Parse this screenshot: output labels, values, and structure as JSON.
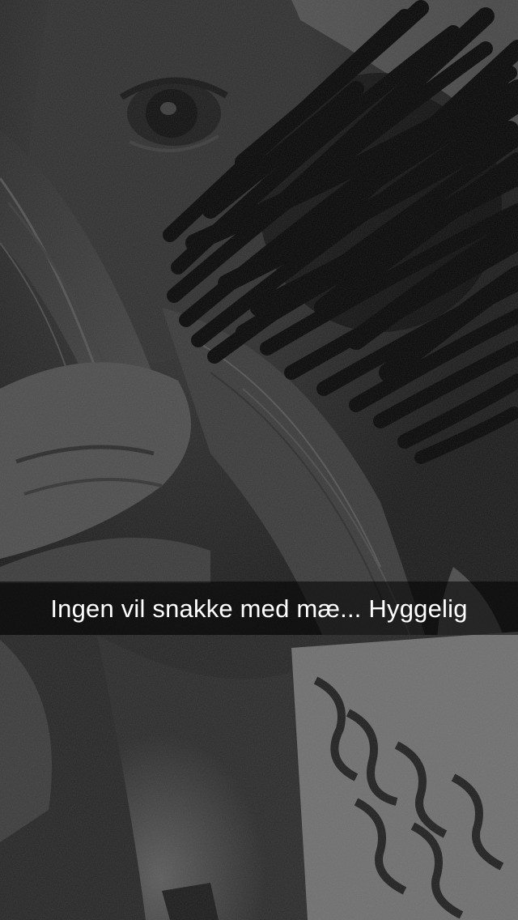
{
  "snap": {
    "caption": "Ingen vil snakke med mæ... Hyggelig"
  },
  "colors": {
    "caption_bar_bg": "#000000",
    "caption_text": "#ffffff",
    "photo_tone": "grayscale"
  }
}
